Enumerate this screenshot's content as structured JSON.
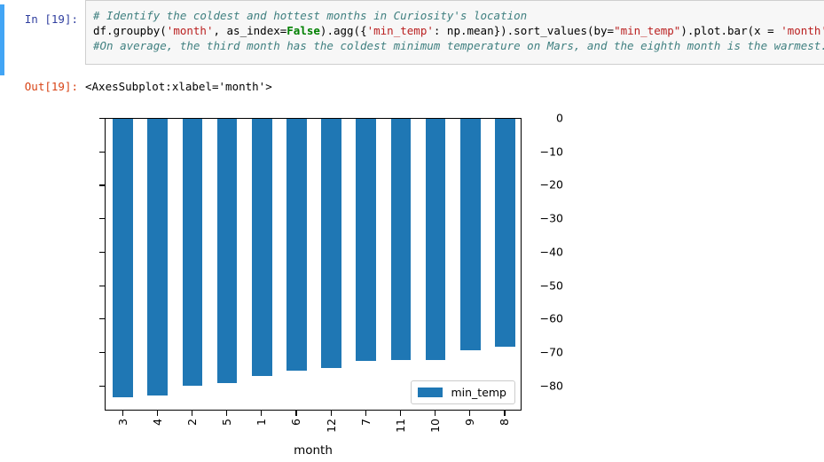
{
  "notebook": {
    "input_prompt": "In [19]:",
    "output_prompt": "Out[19]:",
    "output_text": "<AxesSubplot:xlabel='month'>",
    "code_lines": [
      [
        {
          "t": "comment",
          "s": "# Identify the coldest and hottest months in Curiosity's location"
        }
      ],
      [
        {
          "t": "plain",
          "s": "df.groupby("
        },
        {
          "t": "string",
          "s": "'month'"
        },
        {
          "t": "plain",
          "s": ", as_index="
        },
        {
          "t": "keyword",
          "s": "False"
        },
        {
          "t": "plain",
          "s": ").agg({"
        },
        {
          "t": "string",
          "s": "'min_temp'"
        },
        {
          "t": "plain",
          "s": ": np.mean}).sort_values(by="
        },
        {
          "t": "string",
          "s": "\"min_temp\""
        },
        {
          "t": "plain",
          "s": ").plot.bar(x = "
        },
        {
          "t": "string",
          "s": "'month'"
        },
        {
          "t": "plain",
          "s": ")"
        }
      ],
      [
        {
          "t": "comment",
          "s": "#On average, the third month has the coldest minimum temperature on Mars, and the eighth month is the warmest."
        }
      ]
    ]
  },
  "chart_data": {
    "type": "bar",
    "title": "",
    "xlabel": "month",
    "ylabel": "",
    "categories": [
      "3",
      "4",
      "2",
      "5",
      "1",
      "6",
      "12",
      "7",
      "11",
      "10",
      "9",
      "8"
    ],
    "values": [
      -83.3,
      -82.6,
      -79.9,
      -79.1,
      -76.8,
      -75.3,
      -74.4,
      -72.3,
      -72.0,
      -72.1,
      -69.1,
      -68.2
    ],
    "series": [
      {
        "name": "min_temp",
        "values": [
          -83.3,
          -82.6,
          -79.9,
          -79.1,
          -76.8,
          -75.3,
          -74.4,
          -72.3,
          -72.0,
          -72.1,
          -69.1,
          -68.2
        ]
      }
    ],
    "ylim": [
      -87.5,
      0
    ],
    "yticks": [
      0,
      -10,
      -20,
      -30,
      -40,
      -50,
      -60,
      -70,
      -80
    ],
    "ytick_labels": [
      "0",
      "−10",
      "−20",
      "−30",
      "−40",
      "−50",
      "−60",
      "−70",
      "−80"
    ],
    "legend": {
      "position": "lower-right",
      "entries": [
        {
          "label": "min_temp",
          "color": "#1f77b4"
        }
      ]
    },
    "grid": false,
    "bar_color": "#1f77b4"
  }
}
